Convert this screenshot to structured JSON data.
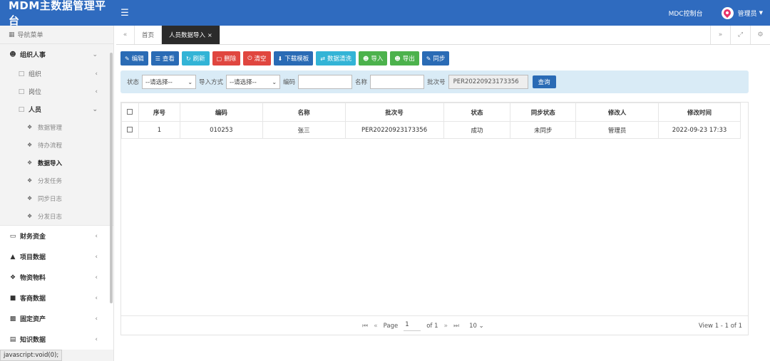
{
  "app": {
    "title": "MDM主数据管理平台",
    "menu_icon": "hamburger-icon"
  },
  "topbar": {
    "console_link": "MDC控制台",
    "user_name": "管理员"
  },
  "sidebar": {
    "header": "导航菜单",
    "groups": [
      {
        "label": "组织人事",
        "icon": "users-icon"
      },
      {
        "label": "组织",
        "icon": "folder-icon"
      },
      {
        "label": "岗位",
        "icon": "folder-icon"
      },
      {
        "label": "人员",
        "icon": "folder-icon"
      },
      {
        "label": "财务资金",
        "icon": "card-icon"
      },
      {
        "label": "项目数据",
        "icon": "sitemap-icon"
      },
      {
        "label": "物资物料",
        "icon": "cubes-icon"
      },
      {
        "label": "客商数据",
        "icon": "briefcase-icon"
      },
      {
        "label": "固定资产",
        "icon": "storage-icon"
      },
      {
        "label": "知识数据",
        "icon": "file-icon"
      }
    ],
    "leaves": [
      "数据管理",
      "待办流程",
      "数据导入",
      "分发任务",
      "同步日志",
      "分发日志"
    ]
  },
  "status_tip": "javascript:void(0);",
  "tabs": {
    "home": "首页",
    "active": "人员数据导入"
  },
  "toolbar": {
    "edit": "编辑",
    "view": "查看",
    "refresh": "刷新",
    "delete": "删除",
    "clear": "清空",
    "download_template": "下载模板",
    "data_cleaning": "数据清洗",
    "import": "导入",
    "export": "导出",
    "sync": "同步"
  },
  "search": {
    "status_label": "状态",
    "status_value": "--请选择--",
    "import_mode_label": "导入方式",
    "import_mode_value": "--请选择--",
    "code_label": "编码",
    "code_value": "",
    "name_label": "名称",
    "name_value": "",
    "batch_label": "批次号",
    "batch_value": "PER20220923173356",
    "query_button": "查询"
  },
  "table": {
    "headers": [
      "序号",
      "编码",
      "名称",
      "批次号",
      "状态",
      "同步状态",
      "修改人",
      "修改时间"
    ],
    "rows": [
      [
        "1",
        "010253",
        "张三",
        "PER20220923173356",
        "成功",
        "未同步",
        "管理员",
        "2022-09-23 17:33"
      ]
    ]
  },
  "pager": {
    "page_label": "Page",
    "page_value": "1",
    "of_label": "of 1",
    "page_size": "10",
    "view_text": "View 1 - 1 of 1"
  }
}
